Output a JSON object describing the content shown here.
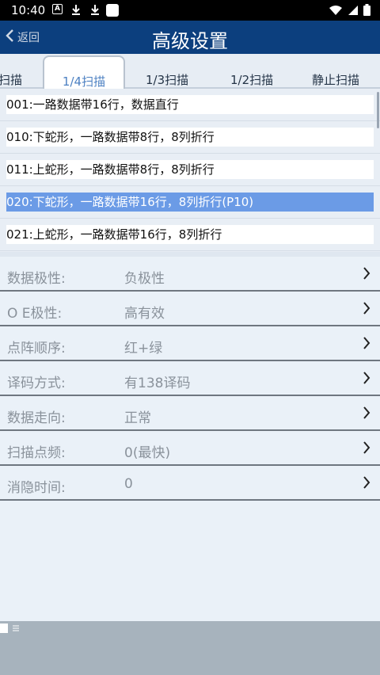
{
  "status_bar": {
    "time": "10:40"
  },
  "header": {
    "back_label": "返回",
    "title": "高级设置"
  },
  "tabs": [
    {
      "label": "扫描",
      "active": false
    },
    {
      "label": "1/4扫描",
      "active": true
    },
    {
      "label": "1/3扫描",
      "active": false
    },
    {
      "label": "1/2扫描",
      "active": false
    },
    {
      "label": "静止扫描",
      "active": false
    }
  ],
  "scan_modes": [
    {
      "text": "001:一路数据带16行，数据直行",
      "selected": false
    },
    {
      "text": "010:下蛇形，一路数据带8行，8列折行",
      "selected": false
    },
    {
      "text": "011:上蛇形，一路数据带8行，8列折行",
      "selected": false
    },
    {
      "text": "020:下蛇形，一路数据带16行，8列折行(P10)",
      "selected": true
    },
    {
      "text": "021:上蛇形，一路数据带16行，8列折行",
      "selected": false
    }
  ],
  "settings": [
    {
      "label": "数据极性:",
      "value": "负极性"
    },
    {
      "label": "O E极性:",
      "value": "高有效"
    },
    {
      "label": "点阵顺序:",
      "value": "红+绿"
    },
    {
      "label": "译码方式:",
      "value": "有138译码"
    },
    {
      "label": "数据走向:",
      "value": "正常"
    },
    {
      "label": "扫描点频:",
      "value": "0(最快)"
    },
    {
      "label": "消隐时间:",
      "value": "0"
    }
  ],
  "colors": {
    "header_bg": "#0c3f7e",
    "selected_row": "#6b9be6",
    "active_tab_text": "#4c80c2"
  },
  "icons": [
    "back-chevron-icon",
    "chevron-right-icon",
    "wifi-icon",
    "signal-icon",
    "battery-icon",
    "download-icon"
  ]
}
